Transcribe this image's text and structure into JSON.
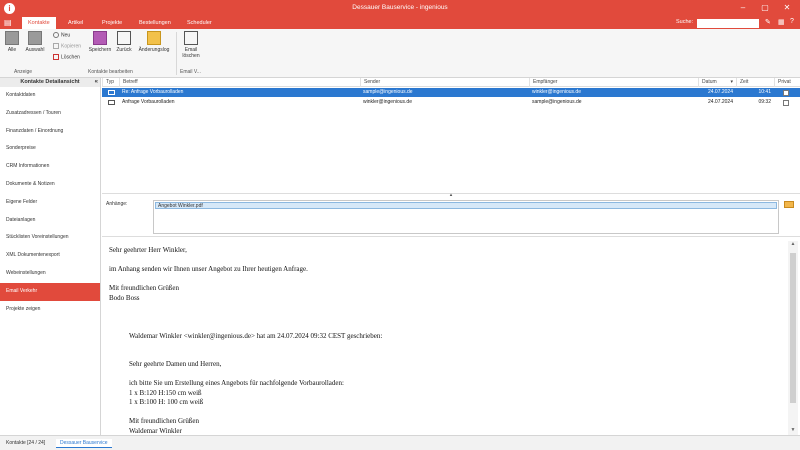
{
  "window": {
    "title": "Dessauer Bauservice - ingenious",
    "minimize": "–",
    "maximize": "▢",
    "close": "✕"
  },
  "tabs": [
    "Kontakte",
    "Artikel",
    "Projekte",
    "Bestellungen",
    "Scheduler"
  ],
  "search": {
    "label": "Suche:",
    "value": ""
  },
  "ribbon": {
    "alle": "Alle",
    "auswahl": "Auswahl",
    "neu": "Neu",
    "kopieren": "Kopieren",
    "loeschen": "Löschen",
    "speichern": "Speichern",
    "zurueck": "Zurück",
    "aenderungslog": "Änderungslog",
    "email_loeschen_1": "Email",
    "email_loeschen_2": "löschen",
    "group_anzeige": "Anzeige",
    "group_kontakte": "Kontakte bearbeiten",
    "group_email": "Email V..."
  },
  "sidebar": {
    "header": "Kontakte Detailansicht",
    "items": [
      "Kontaktdaten",
      "Zusatzadressen / Touren",
      "Finanzdaten / Einordnung",
      "Sonderpreise",
      "CRM Informationen",
      "Dokumente & Notizen",
      "Eigene Felder",
      "Dateianlagen",
      "Stücklisten Voreinstellungen",
      "XML Dokumentenexport",
      "Webeinstellungen",
      "Email Verkehr",
      "Projekte zeigen"
    ]
  },
  "list": {
    "headers": {
      "typ": "Typ",
      "betreff": "Betreff",
      "sender": "Sender",
      "empfaenger": "Empfänger",
      "datum": "Datum",
      "zeit": "Zeit",
      "privat": "Privat"
    },
    "rows": [
      {
        "betreff": "Re: Anfrage Vorbaurolladen",
        "sender": "sample@ingenious.de",
        "empfaenger": "winkler@ingenious.de",
        "datum": "24.07.2024",
        "zeit": "10:41"
      },
      {
        "betreff": "Anfrage Vorbaurolladen",
        "sender": "winkler@ingenious.de",
        "empfaenger": "sample@ingenious.de",
        "datum": "24.07.2024",
        "zeit": "09:32"
      }
    ]
  },
  "attachments": {
    "label": "Anhänge:",
    "file": "Angebot Winkler.pdf"
  },
  "mail": {
    "l1": "Sehr geehrter Herr Winkler,",
    "l2": "im Anhang senden wir Ihnen unser Angebot zu Ihrer heutigen Anfrage.",
    "l3": "Mit freundlichen Grüßen",
    "l4": "Bodo Boss",
    "q1": "Waldemar Winkler <winkler@ingenious.de> hat am 24.07.2024 09:32 CEST geschrieben:",
    "q2": "Sehr geehrte Damen und Herren,",
    "q3": "ich bitte Sie um Erstellung eines Angebots für nachfolgende Vorbaurolladen:",
    "q4": "1 x B:120 H:150 cm weiß",
    "q5": "1 x B:100 H: 100 cm weiß",
    "q6": "Mit freundlichen Grüßen",
    "q7": "Waldemar Winkler"
  },
  "status": {
    "kontakte": "Kontakte [24 / 24]",
    "tab": "Dessauer Bauservice"
  }
}
